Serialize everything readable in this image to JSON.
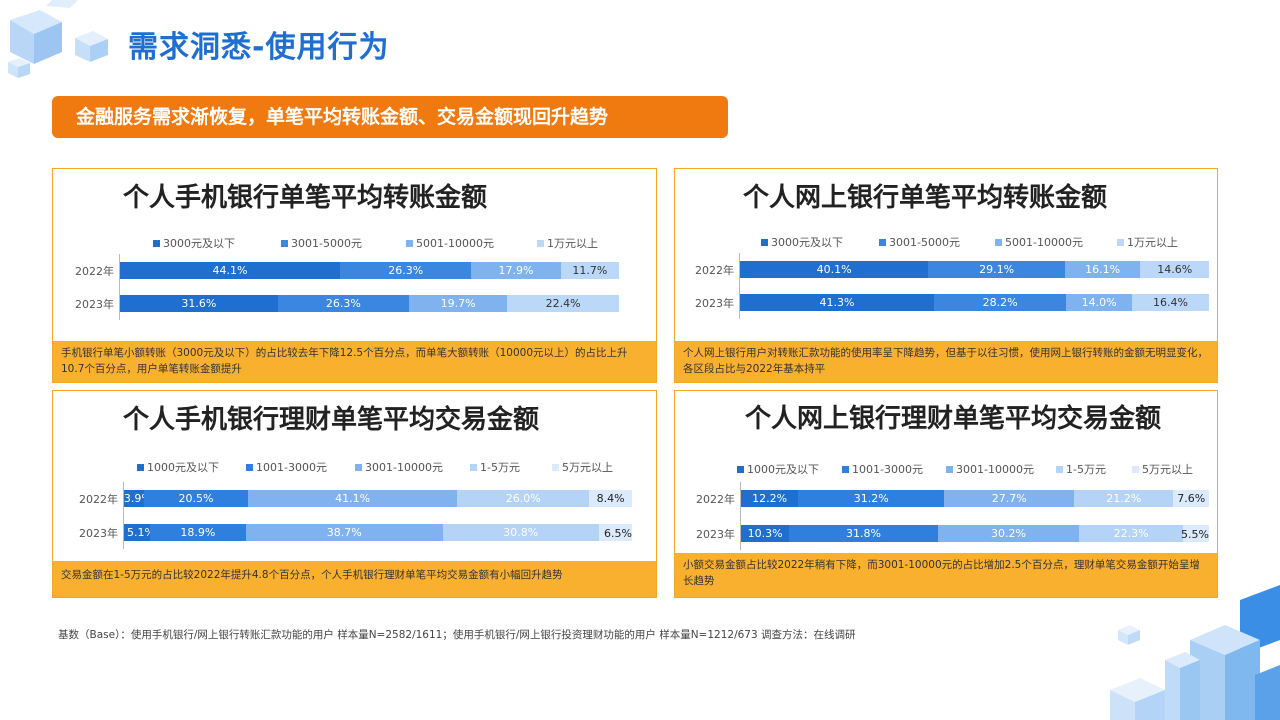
{
  "page": {
    "title": "需求洞悉-使用行为",
    "banner": "金融服务需求渐恢复，单笔平均转账金额、交易金额现回升趋势",
    "footnote": "基数（Base）：使用手机银行/网上银行转账汇款功能的用户  样本量N=2582/1611；使用手机银行/网上银行投资理财功能的用户  样本量N=1212/673  调查方法：在线调研"
  },
  "colors": {
    "accent": "#1f6fd1",
    "banner": "#f07a0f",
    "panel_border": "#f5a623",
    "note_bg": "#f9b02f"
  },
  "chart_data": [
    {
      "type": "bar",
      "stacked": "percent",
      "orientation": "horizontal",
      "title": "个人手机银行单笔平均转账金额",
      "categories": [
        "2022年",
        "2023年"
      ],
      "series": [
        {
          "name": "3000元及以下",
          "values": [
            44.1,
            31.6
          ],
          "labels": [
            "44.1%",
            "31.6%"
          ],
          "color": "#1f6fd1"
        },
        {
          "name": "3001-5000元",
          "values": [
            26.3,
            26.3
          ],
          "labels": [
            "26.3%",
            "26.3%"
          ],
          "color": "#3b86e0"
        },
        {
          "name": "5001-10000元",
          "values": [
            17.9,
            19.7
          ],
          "labels": [
            "17.9%",
            "19.7%"
          ],
          "color": "#7fb2ee"
        },
        {
          "name": "1万元以上",
          "values": [
            11.7,
            22.4
          ],
          "labels": [
            "11.7%",
            "22.4%"
          ],
          "color": "#bcd8f8"
        }
      ],
      "note": "手机银行单笔小额转账（3000元及以下）的占比较去年下降12.5个百分点，而单笔大额转账（10000元以上）的占比上升10.7个百分点，用户单笔转账金额提升"
    },
    {
      "type": "bar",
      "stacked": "percent",
      "orientation": "horizontal",
      "title": "个人网上银行单笔平均转账金额",
      "categories": [
        "2022年",
        "2023年"
      ],
      "series": [
        {
          "name": "3000元及以下",
          "values": [
            40.1,
            41.3
          ],
          "labels": [
            "40.1%",
            "41.3%"
          ],
          "color": "#1f6fd1"
        },
        {
          "name": "3001-5000元",
          "values": [
            29.1,
            28.2
          ],
          "labels": [
            "29.1%",
            "28.2%"
          ],
          "color": "#3b86e0"
        },
        {
          "name": "5001-10000元",
          "values": [
            16.1,
            14.0
          ],
          "labels": [
            "16.1%",
            "14.0%"
          ],
          "color": "#7fb2ee"
        },
        {
          "name": "1万元以上",
          "values": [
            14.6,
            16.4
          ],
          "labels": [
            "14.6%",
            "16.4%"
          ],
          "color": "#bcd8f8"
        }
      ],
      "note": "个人网上银行用户对转账汇款功能的使用率呈下降趋势，但基于以往习惯，使用网上银行转账的金额无明显变化，各区段占比与2022年基本持平"
    },
    {
      "type": "bar",
      "stacked": "percent",
      "orientation": "horizontal",
      "title": "个人手机银行理财单笔平均交易金额",
      "categories": [
        "2022年",
        "2023年"
      ],
      "series": [
        {
          "name": "1000元及以下",
          "values": [
            3.9,
            5.1
          ],
          "labels": [
            "3.9%",
            "5.1%"
          ],
          "color": "#1f6fd1"
        },
        {
          "name": "1001-3000元",
          "values": [
            20.5,
            18.9
          ],
          "labels": [
            "20.5%",
            "18.9%"
          ],
          "color": "#2f7fde"
        },
        {
          "name": "3001-10000元",
          "values": [
            41.1,
            38.7
          ],
          "labels": [
            "41.1%",
            "38.7%"
          ],
          "color": "#7fb2ee"
        },
        {
          "name": "1-5万元",
          "values": [
            26.0,
            30.8
          ],
          "labels": [
            "26.0%",
            "30.8%"
          ],
          "color": "#b4d3f7"
        },
        {
          "name": "5万元以上",
          "values": [
            8.4,
            6.5
          ],
          "labels": [
            "8.4%",
            "6.5%"
          ],
          "color": "#dbeafc"
        }
      ],
      "note": "交易金额在1-5万元的占比较2022年提升4.8个百分点，个人手机银行理财单笔平均交易金额有小幅回升趋势"
    },
    {
      "type": "bar",
      "stacked": "percent",
      "orientation": "horizontal",
      "title": "个人网上银行理财单笔平均交易金额",
      "categories": [
        "2022年",
        "2023年"
      ],
      "series": [
        {
          "name": "1000元及以下",
          "values": [
            12.2,
            10.3
          ],
          "labels": [
            "12.2%",
            "10.3%"
          ],
          "color": "#1f6fd1"
        },
        {
          "name": "1001-3000元",
          "values": [
            31.2,
            31.8
          ],
          "labels": [
            "31.2%",
            "31.8%"
          ],
          "color": "#2f7fde"
        },
        {
          "name": "3001-10000元",
          "values": [
            27.7,
            30.2
          ],
          "labels": [
            "27.7%",
            "30.2%"
          ],
          "color": "#7fb2ee"
        },
        {
          "name": "1-5万元",
          "values": [
            21.2,
            22.3
          ],
          "labels": [
            "21.2%",
            "22.3%"
          ],
          "color": "#b4d3f7"
        },
        {
          "name": "5万元以上",
          "values": [
            7.6,
            5.5
          ],
          "labels": [
            "7.6%",
            "5.5%"
          ],
          "color": "#dbeafc"
        }
      ],
      "note": "小额交易金额占比较2022年稍有下降，而3001-10000元的占比增加2.5个百分点，理财单笔交易金额开始呈增长趋势"
    }
  ]
}
